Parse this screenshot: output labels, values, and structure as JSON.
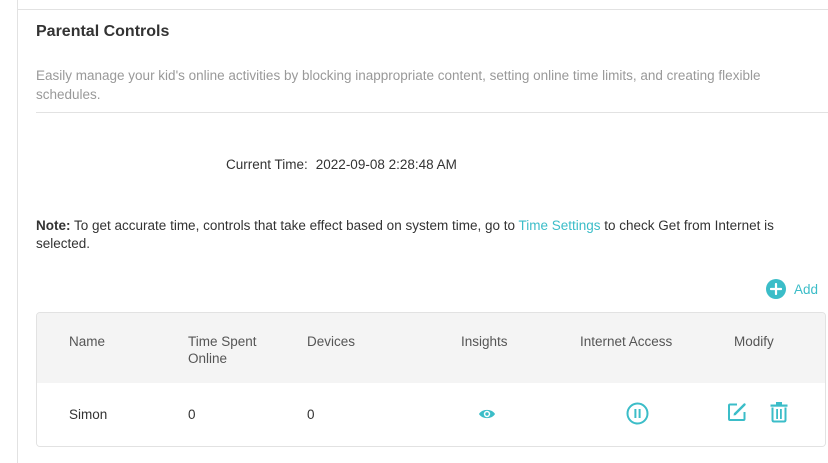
{
  "page": {
    "title": "Parental Controls",
    "description": "Easily manage your kid's online activities by blocking inappropriate content, setting online time limits, and creating flexible schedules."
  },
  "current_time": {
    "label": "Current Time:",
    "value": "2022-09-08 2:28:48 AM"
  },
  "note": {
    "prefix": "Note:",
    "text_before_link": " To get accurate time, controls that take effect based on system time, go to ",
    "link": "Time Settings",
    "text_after_link": " to check Get from Internet is selected."
  },
  "toolbar": {
    "add_label": "Add",
    "add_icon": "plus-circle-icon"
  },
  "table": {
    "headers": {
      "name": "Name",
      "time_spent_line1": "Time Spent",
      "time_spent_line2": "Online",
      "devices": "Devices",
      "insights": "Insights",
      "internet_access": "Internet Access",
      "modify": "Modify"
    },
    "rows": [
      {
        "name": "Simon",
        "time_spent": "0",
        "devices": "0",
        "insights_icon": "eye-icon",
        "internet_access_icon": "pause-icon",
        "modify_icons": [
          "edit-icon",
          "trash-icon"
        ]
      }
    ]
  },
  "colors": {
    "accent": "#3bbdc8",
    "title_text": "#333333",
    "muted_text": "#999999",
    "header_bg": "#f4f4f4",
    "border": "#e2e2e2"
  }
}
